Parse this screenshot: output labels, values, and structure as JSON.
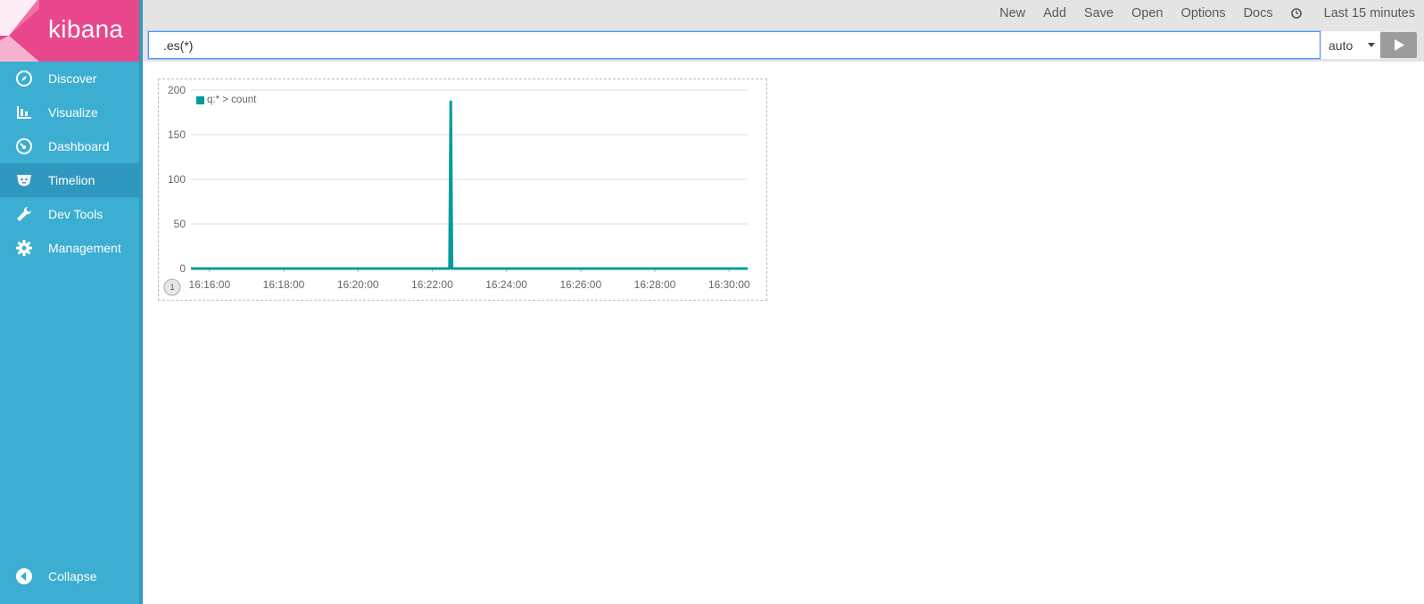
{
  "app": {
    "name": "kibana"
  },
  "sidebar": {
    "items": [
      {
        "label": "Discover",
        "icon": "compass-icon"
      },
      {
        "label": "Visualize",
        "icon": "bar-chart-icon"
      },
      {
        "label": "Dashboard",
        "icon": "dashboard-icon"
      },
      {
        "label": "Timelion",
        "icon": "timelion-icon",
        "active": true
      },
      {
        "label": "Dev Tools",
        "icon": "wrench-icon"
      },
      {
        "label": "Management",
        "icon": "gear-icon"
      }
    ],
    "collapse_label": "Collapse"
  },
  "topbar": {
    "menu": {
      "new": "New",
      "add": "Add",
      "save": "Save",
      "open": "Open",
      "options": "Options",
      "docs": "Docs",
      "time": "Last 15 minutes"
    },
    "query": ".es(*)",
    "interval": "auto"
  },
  "colors": {
    "brand": "#e8488b",
    "sidebar": "#3caed2",
    "series": "#019b9b"
  },
  "chart_data": {
    "type": "line",
    "legend": [
      "q:* > count"
    ],
    "series": [
      {
        "name": "q:* > count",
        "x": [
          "16:15:30",
          "16:22:28",
          "16:22:30",
          "16:22:32",
          "16:30:30"
        ],
        "values": [
          0,
          0,
          187,
          0,
          0
        ]
      }
    ],
    "ylim": [
      0,
      200
    ],
    "yticks": [
      "200",
      "150",
      "100",
      "50",
      "0"
    ],
    "xticks": [
      "16:16:00",
      "16:18:00",
      "16:20:00",
      "16:22:00",
      "16:24:00",
      "16:26:00",
      "16:28:00",
      "16:30:00"
    ],
    "grid": true,
    "legend_position": "top-left",
    "badge": "1"
  }
}
